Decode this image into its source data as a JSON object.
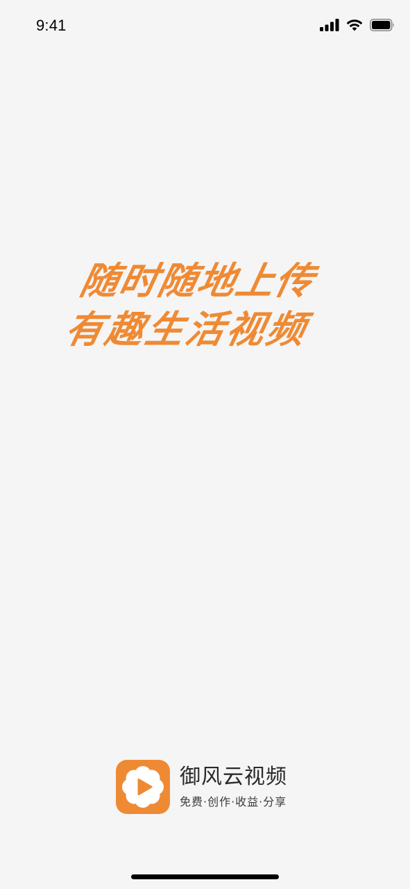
{
  "status_bar": {
    "time": "9:41",
    "icons": [
      "cellular-signal-icon",
      "wifi-icon",
      "battery-icon"
    ]
  },
  "slogan": {
    "line1": "随时随地上传",
    "line2": "有趣生活视频"
  },
  "brand": {
    "logo_icon": "play-flower-icon",
    "name": "御风云视频",
    "tagline": "免费·创作·收益·分享"
  },
  "colors": {
    "accent": "#ef8a34",
    "background": "#f5f5f5",
    "text_dark": "#2a2a2a"
  }
}
